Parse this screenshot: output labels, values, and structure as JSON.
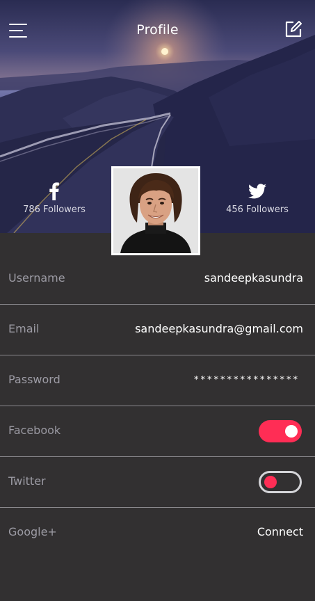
{
  "header": {
    "title": "Profile",
    "menu_icon": "hamburger-menu-icon",
    "edit_icon": "edit-icon"
  },
  "social": {
    "facebook": {
      "icon": "facebook-icon",
      "followers": "786 Followers"
    },
    "twitter": {
      "icon": "twitter-icon",
      "followers": "456 Followers"
    }
  },
  "fields": {
    "username": {
      "label": "Username",
      "value": "sandeepkasundra"
    },
    "email": {
      "label": "Email",
      "value": "sandeepkasundra@gmail.com"
    },
    "password": {
      "label": "Password",
      "value": "****************"
    },
    "facebook": {
      "label": "Facebook",
      "toggle": "on"
    },
    "twitter": {
      "label": "Twitter",
      "toggle": "off"
    },
    "google": {
      "label": "Google+",
      "action": "Connect"
    }
  },
  "colors": {
    "accent": "#ff2d55",
    "background": "#323031",
    "label": "#9c9ba4",
    "divider": "#8b8a8e"
  }
}
